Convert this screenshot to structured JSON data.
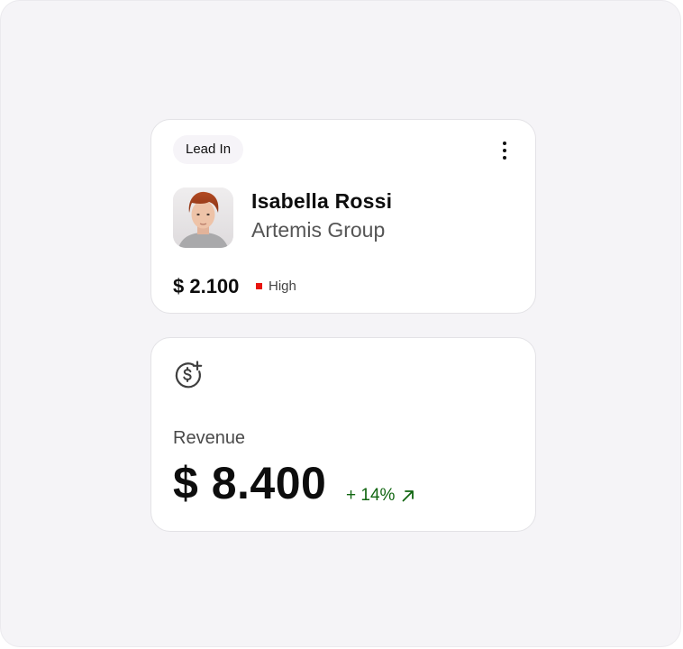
{
  "lead_card": {
    "stage": "Lead In",
    "contact_name": "Isabella Rossi",
    "company": "Artemis Group",
    "deal_amount": "$ 2.100",
    "priority": {
      "label": "High",
      "color": "#e8150f"
    },
    "menu_icon": "more-vertical-icon",
    "avatar_icon": "avatar"
  },
  "revenue_card": {
    "icon": "dollar-plus-icon",
    "label": "Revenue",
    "value": "$ 8.400",
    "change": "+ 14%",
    "change_icon": "arrow-up-right-icon",
    "change_color": "#116611"
  }
}
